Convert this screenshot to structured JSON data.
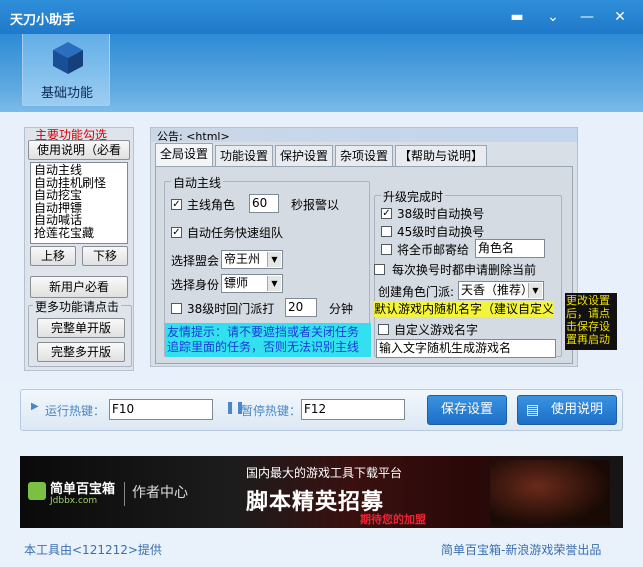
{
  "window": {
    "title": "天刀小助手"
  },
  "nav": {
    "basic_label": "基础功能"
  },
  "left": {
    "section_title": "主要功能勾选",
    "help_button": "使用说明（必看",
    "features": [
      "自动主线",
      "自动挂机刷怪",
      "自动挖宝",
      "自动押镖",
      "自动喊话",
      "抢莲花宝藏"
    ],
    "up_button": "上移",
    "down_button": "下移",
    "new_user_button": "新用户必看",
    "more_title": "更多功能请点击",
    "single_button": "完整单开版",
    "multi_button": "完整多开版"
  },
  "main": {
    "notice": "公告: <html>",
    "tabs": [
      "全局设置",
      "功能设置",
      "保护设置",
      "杂项设置",
      "【帮助与说明】"
    ],
    "auto_main": {
      "title": "自动主线",
      "main_role_label": "主线角色",
      "main_role_value": "60",
      "alarm_label": "秒报警以",
      "auto_team_label": "自动任务快速组队",
      "alliance_label": "选择盟会",
      "alliance_value": "帝王州",
      "identity_label": "选择身份",
      "identity_value": "镖师",
      "return_label": "38级时回门派打",
      "return_value": "20",
      "return_unit": "分钟",
      "tip": "友情提示：请不要遮挡或者关闭任务追踪里面的任务，否则无法识别主线"
    },
    "upgrade": {
      "title": "升级完成时",
      "opt38": "38级时自动换号",
      "opt45": "45级时自动换号",
      "mail_label": "将全币邮寄给",
      "mail_placeholder": "角色名",
      "delete_label": "每次换号时都申请删除当前",
      "create_label": "创建角色门派:",
      "create_value": "天香（推荐）",
      "random_name": "默认游戏内随机名字（建议自定义",
      "custom_name_label": "自定义游戏名字",
      "custom_name_placeholder": "输入文字随机生成游戏名"
    },
    "side_notice": "更改设置后，请点击保存设置再启动"
  },
  "hotkeys": {
    "run_label": "运行热键：",
    "run_value": "F10",
    "pause_label": "暂停热键：",
    "pause_value": "F12",
    "save_button": "保存设置",
    "help_button": "使用说明"
  },
  "banner": {
    "brand": "简单百宝箱",
    "brand_url": "Jdbbx.com",
    "center": "作者中心",
    "tagline": "国内最大的游戏工具下载平台",
    "headline": "脚本精英招募",
    "sub": "期待您的加盟"
  },
  "footer": {
    "left": "本工具由<121212>提供",
    "right": "简单百宝箱-新浪游戏荣誉出品"
  }
}
